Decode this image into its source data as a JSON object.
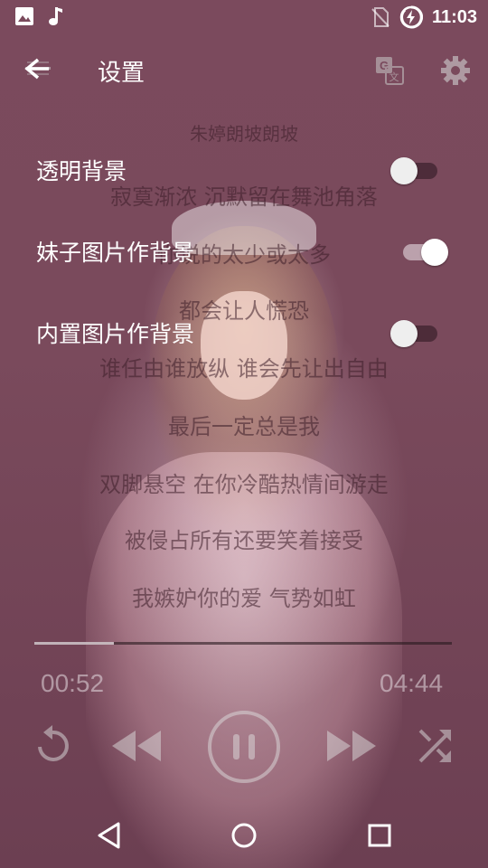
{
  "status_bar": {
    "left_icons": [
      "image-icon",
      "music-note-icon"
    ],
    "right_icons": [
      "no-sim-icon",
      "battery-charging-icon"
    ],
    "time": "11:03"
  },
  "toolbar": {
    "title": "设置",
    "back_icon": "arrow-back-icon",
    "translate_icon": "translate-icon",
    "settings_icon": "gear-icon"
  },
  "lyrics": [
    "朱婷朗坡朗坡",
    "寂寞渐浓 沉默留在舞池角落",
    "你说的太少或太多",
    "都会让人慌恐",
    "谁任由谁放纵 谁会先让出自由",
    "最后一定总是我",
    "双脚悬空 在你冷酷热情间游走",
    "被侵占所有还要笑着接受",
    "我嫉妒你的爱 气势如虹"
  ],
  "settings": [
    {
      "label": "透明背景",
      "enabled": false
    },
    {
      "label": "妹子图片作背景",
      "enabled": true
    },
    {
      "label": "内置图片作背景",
      "enabled": false
    }
  ],
  "player": {
    "progress": 0.19,
    "elapsed": "00:52",
    "duration": "04:44",
    "controls": [
      "repeat-icon",
      "rewind-icon",
      "pause-icon",
      "fast-forward-icon",
      "shuffle-icon"
    ]
  },
  "nav_bar": [
    "back-triangle-icon",
    "home-circle-icon",
    "recents-square-icon"
  ],
  "colors": {
    "background_tint": "#7a4a5c",
    "text_primary": "#ffffff"
  }
}
